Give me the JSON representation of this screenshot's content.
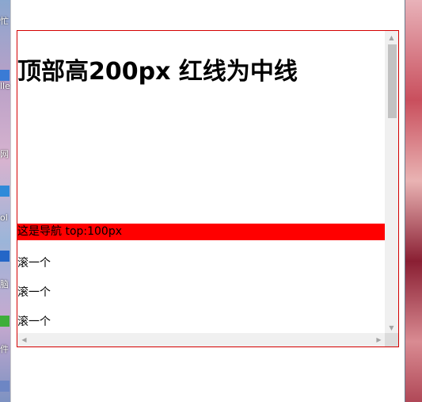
{
  "desktop": {
    "left_fragments": [
      "忙",
      "lle",
      "网",
      "ol",
      "脑",
      "件"
    ]
  },
  "box": {
    "heading": "顶部高200px 红线为中线",
    "nav_text": "这是导航 top:100px",
    "items": [
      "滚一个",
      "滚一个",
      "滚一个"
    ]
  },
  "icons": {
    "scroll_up": "scroll-up-arrow",
    "scroll_down": "scroll-down-arrow",
    "scroll_left": "scroll-left-arrow",
    "scroll_right": "scroll-right-arrow"
  },
  "colors": {
    "box_border": "#d40000",
    "nav_background": "#ff0000"
  }
}
